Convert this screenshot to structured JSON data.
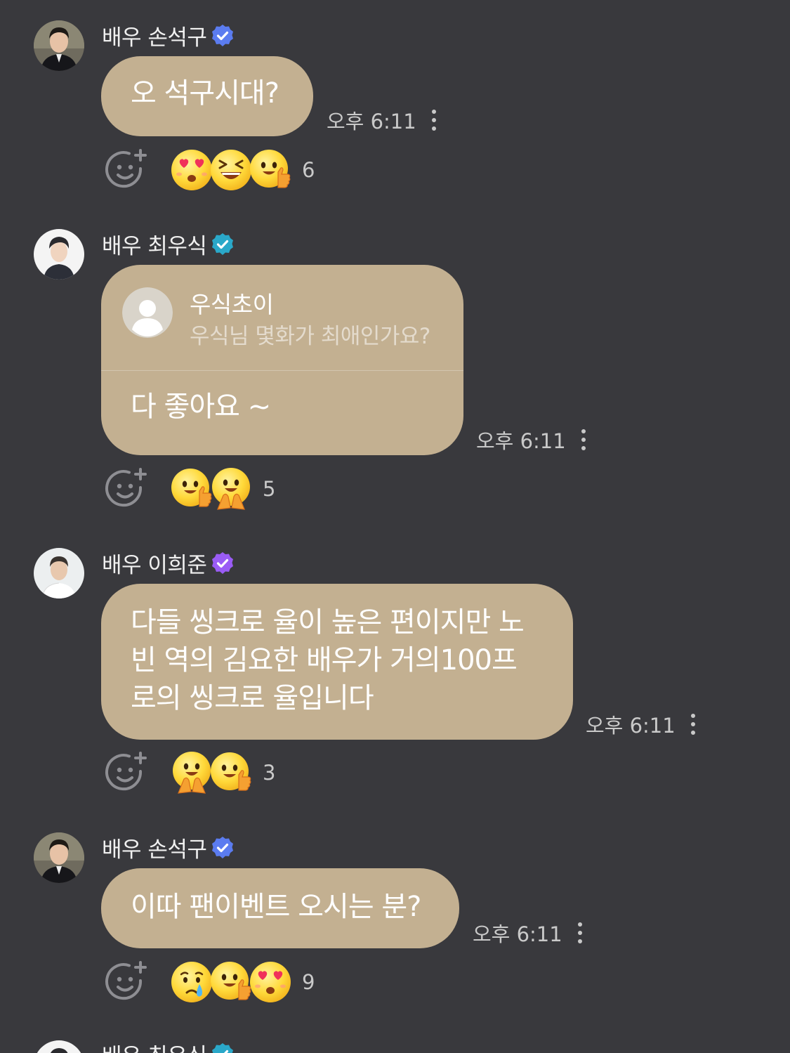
{
  "messages": [
    {
      "author": "배우 손석구",
      "text": "오 석구시대?",
      "time": "오후 6:11",
      "reactions": [
        "heart-eyes-emoji",
        "laughing-emoji",
        "thumbs-up-emoji"
      ],
      "reaction_count": "6"
    },
    {
      "author": "배우 최우식",
      "reply_to_name": "우식초이",
      "reply_to_text": "우식님 몇화가 최애인가요?",
      "text": "다 좋아요 ~",
      "time": "오후 6:11",
      "reactions": [
        "thumbs-up-emoji",
        "praying-emoji"
      ],
      "reaction_count": "5"
    },
    {
      "author": "배우 이희준",
      "text_lines": [
        "다들 씽크로 율이 높은 편이지만 노",
        "빈 역의 김요한 배우가 거의100프",
        "로의 씽크로 율입니다"
      ],
      "time": "오후 6:11",
      "reactions": [
        "praying-emoji",
        "thumbs-up-emoji"
      ],
      "reaction_count": "3"
    },
    {
      "author": "배우 손석구",
      "text": "이따 팬이벤트 오시는 분?",
      "time": "오후 6:11",
      "reactions": [
        "crying-emoji",
        "thumbs-up-emoji",
        "heart-eyes-emoji"
      ],
      "reaction_count": "9"
    },
    {
      "author": "배우 최우식"
    }
  ],
  "colors": {
    "background": "#39393d",
    "bubble": "#c3b091",
    "badge_blue": "#5b7cf0",
    "badge_teal": "#2aa8c9",
    "badge_purple": "#9a5cf5"
  }
}
